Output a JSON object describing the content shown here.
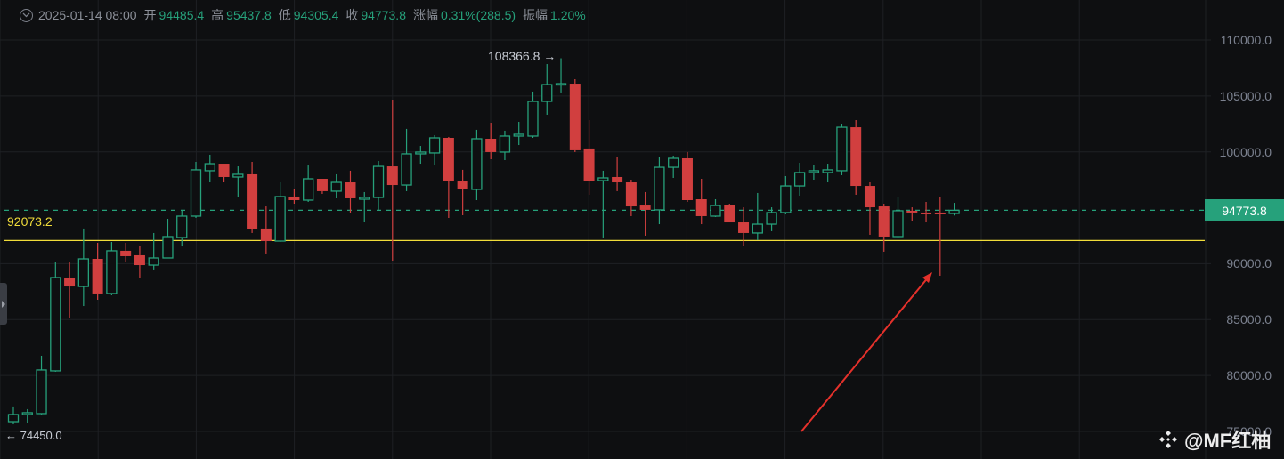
{
  "header": {
    "datetime": "2025-01-14 08:00",
    "open_label": "开",
    "open": "94485.4",
    "high_label": "高",
    "high": "95437.8",
    "low_label": "低",
    "low": "94305.4",
    "close_label": "收",
    "close": "94773.8",
    "change_label": "涨幅",
    "change": "0.31%(288.5)",
    "amplitude_label": "振幅",
    "amplitude": "1.20%"
  },
  "colors": {
    "up": "#26a17b",
    "down": "#d13f3f",
    "level": "#f0dc3a",
    "background": "#0e0f11"
  },
  "chart_data": {
    "type": "candlestick",
    "ohlc_order": [
      "open",
      "high",
      "low",
      "close"
    ],
    "ylim": [
      74000,
      112000
    ],
    "y_ticks": [
      "110000.0",
      "105000.0",
      "100000.0",
      "90000.0",
      "85000.0",
      "80000.0",
      "75000.0"
    ],
    "y_tick_values": [
      110000,
      105000,
      100000,
      90000,
      85000,
      80000,
      75000
    ],
    "grid": true,
    "current_price": 94773.8,
    "current_price_label": "94773.8",
    "horizontal_level": 92073.2,
    "horizontal_level_label": "92073.2",
    "max_label": "108366.8 →",
    "min_label": "← 74450.0",
    "annotation": "red arrow pointing to long lower wick",
    "candles": [
      [
        75870,
        77230,
        75630,
        76510
      ],
      [
        76510,
        76990,
        75790,
        76670
      ],
      [
        76590,
        81760,
        76510,
        80490
      ],
      [
        80410,
        90110,
        80330,
        88760
      ],
      [
        88760,
        90110,
        85180,
        87960
      ],
      [
        87960,
        93140,
        86210,
        90430
      ],
      [
        90430,
        91860,
        86770,
        87330
      ],
      [
        87330,
        91940,
        87170,
        91150
      ],
      [
        91150,
        91860,
        90190,
        90670
      ],
      [
        90750,
        91620,
        88760,
        89870
      ],
      [
        89870,
        92740,
        89480,
        90510
      ],
      [
        90510,
        94010,
        90510,
        92420
      ],
      [
        92340,
        94810,
        91540,
        94250
      ],
      [
        94250,
        99100,
        94090,
        98390
      ],
      [
        98310,
        99740,
        97270,
        98940
      ],
      [
        98940,
        98940,
        97270,
        97750
      ],
      [
        97750,
        98700,
        95920,
        97990
      ],
      [
        97990,
        99100,
        92740,
        93060
      ],
      [
        93140,
        95120,
        90910,
        92020
      ],
      [
        92020,
        97270,
        91940,
        96000
      ],
      [
        96000,
        96640,
        95360,
        95680
      ],
      [
        95680,
        98780,
        95520,
        97590
      ],
      [
        97590,
        97590,
        96240,
        96480
      ],
      [
        96480,
        97990,
        95840,
        97270
      ],
      [
        97270,
        98310,
        94490,
        95840
      ],
      [
        95760,
        96400,
        93690,
        95920
      ],
      [
        95920,
        99180,
        94730,
        98700
      ],
      [
        98700,
        104670,
        90270,
        97030
      ],
      [
        97030,
        102050,
        96480,
        99820
      ],
      [
        99820,
        100530,
        98940,
        99980
      ],
      [
        99900,
        101490,
        98780,
        101250
      ],
      [
        101250,
        101330,
        94090,
        97350
      ],
      [
        97350,
        98390,
        94330,
        96640
      ],
      [
        96640,
        101970,
        95680,
        101170
      ],
      [
        101170,
        102600,
        99340,
        99980
      ],
      [
        99980,
        101890,
        99260,
        101410
      ],
      [
        101410,
        102680,
        100610,
        101570
      ],
      [
        101410,
        105390,
        101250,
        104510
      ],
      [
        104510,
        107850,
        103320,
        106020
      ],
      [
        106020,
        108366.8,
        105310,
        106100
      ],
      [
        106100,
        106500,
        99980,
        100140
      ],
      [
        100300,
        102840,
        96160,
        97430
      ],
      [
        97430,
        98310,
        92340,
        97670
      ],
      [
        97750,
        99500,
        96480,
        97270
      ],
      [
        97270,
        97510,
        94250,
        95120
      ],
      [
        95200,
        96400,
        92500,
        94810
      ],
      [
        94810,
        99500,
        93530,
        98620
      ],
      [
        98620,
        99660,
        97670,
        99420
      ],
      [
        99420,
        99980,
        95520,
        95680
      ],
      [
        95760,
        97590,
        93530,
        94250
      ],
      [
        94250,
        95760,
        94170,
        95200
      ],
      [
        95280,
        95360,
        93690,
        93690
      ],
      [
        93690,
        95040,
        91620,
        92740
      ],
      [
        92740,
        96320,
        92100,
        93530
      ],
      [
        93530,
        95040,
        92900,
        94570
      ],
      [
        94570,
        97830,
        94410,
        96950
      ],
      [
        96950,
        99020,
        96080,
        98150
      ],
      [
        98150,
        98860,
        97510,
        98310
      ],
      [
        98150,
        98940,
        97270,
        98390
      ],
      [
        98310,
        102520,
        97910,
        102200
      ],
      [
        102200,
        102840,
        96160,
        96950
      ],
      [
        96950,
        97270,
        92580,
        95040
      ],
      [
        95120,
        95360,
        91070,
        92420
      ],
      [
        92420,
        95920,
        92260,
        94730
      ],
      [
        94730,
        95040,
        93850,
        94570
      ],
      [
        94570,
        95520,
        93690,
        94410
      ],
      [
        94570,
        96000,
        88920,
        94410
      ],
      [
        94485.4,
        95437.8,
        94305.4,
        94773.8
      ]
    ]
  },
  "watermark": "@MF红柚"
}
